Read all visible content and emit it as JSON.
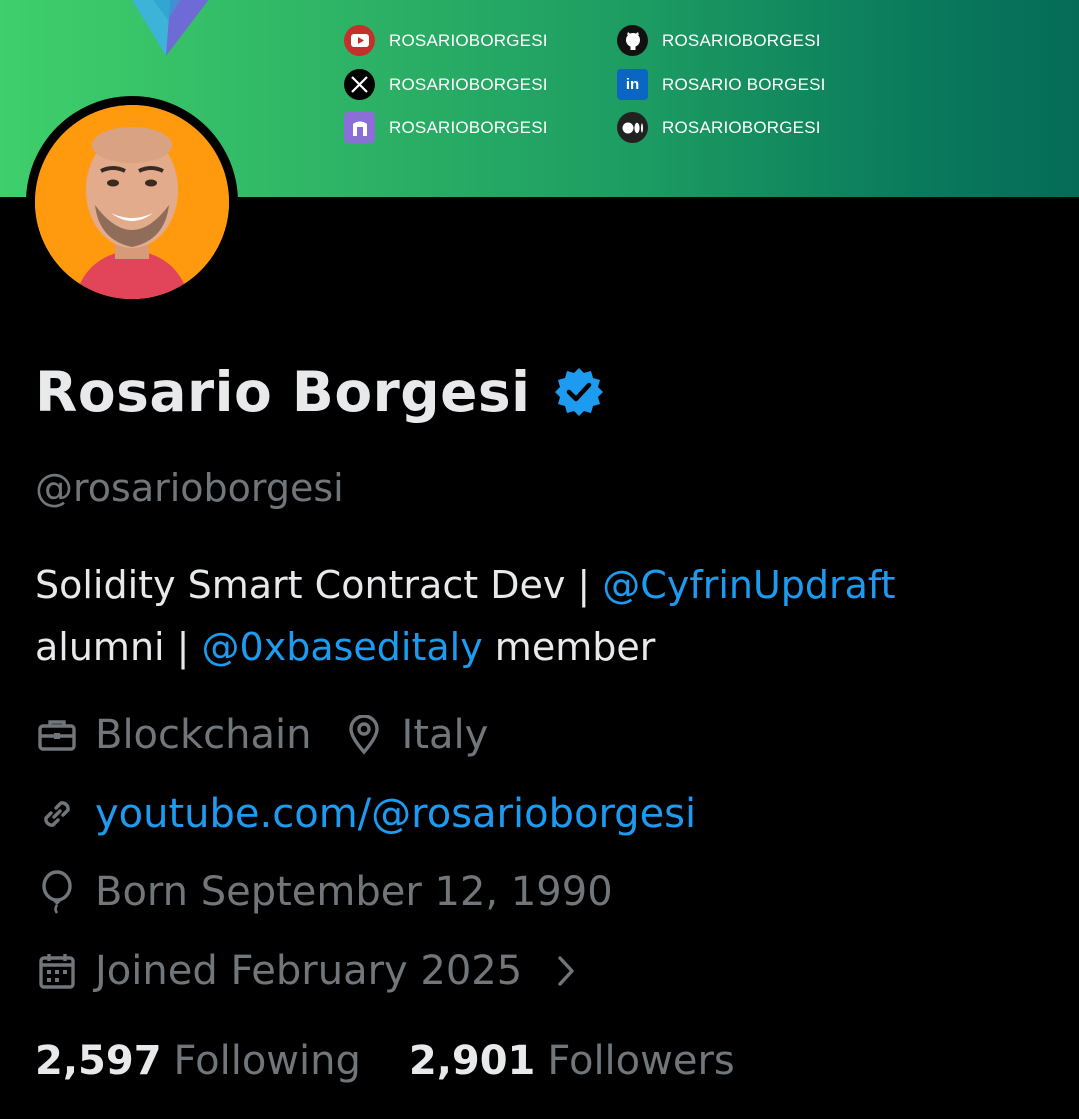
{
  "profile": {
    "name": "Rosario Borgesi",
    "handle": "@rosarioborgesi",
    "bio": {
      "text1": "Solidity Smart Contract Dev | ",
      "mention1": "@CyfrinUpdraft",
      "text2": "alumni | ",
      "mention2": "@0xbaseditaly",
      "text3": " member"
    },
    "category": "Blockchain",
    "location": "Italy",
    "website": "youtube.com/@rosarioborgesi",
    "birthday": "Born September 12, 1990",
    "joined": "Joined February 2025",
    "following_count": "2,597",
    "following_label": "Following",
    "followers_count": "2,901",
    "followers_label": "Followers"
  },
  "banner": {
    "socials": [
      {
        "icon": "youtube-icon",
        "label": "ROSARIOBORGESI"
      },
      {
        "icon": "github-icon",
        "label": "ROSARIOBORGESI"
      },
      {
        "icon": "x-icon",
        "label": "ROSARIOBORGESI"
      },
      {
        "icon": "linkedin-icon",
        "label": "ROSARIO BORGESI"
      },
      {
        "icon": "arch-icon",
        "label": "ROSARIOBORGESI"
      },
      {
        "icon": "medium-icon",
        "label": "ROSARIOBORGESI"
      }
    ]
  },
  "colors": {
    "accent": "#1d9bf0",
    "muted": "#71767b",
    "text": "#e7e9ea",
    "background": "#000000",
    "avatar_bg": "#ff9a0f"
  }
}
